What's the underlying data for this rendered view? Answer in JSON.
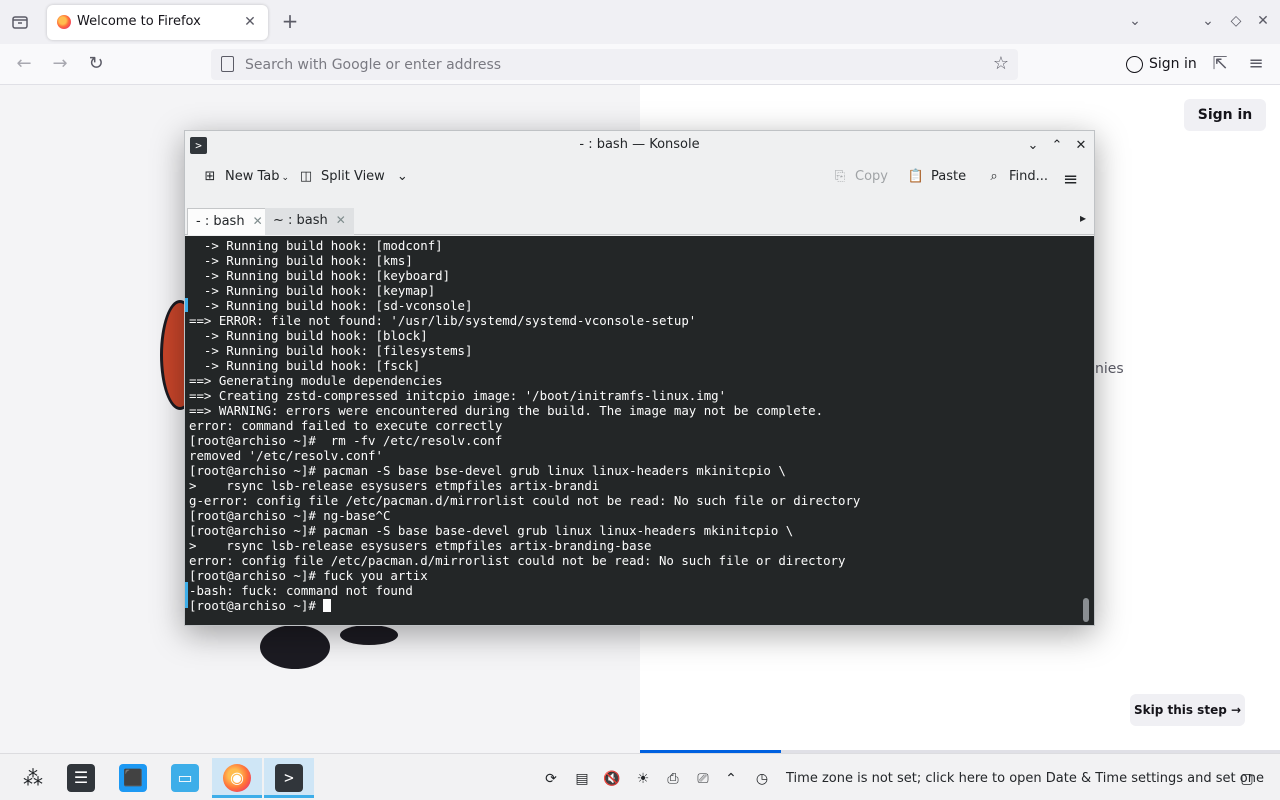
{
  "firefox": {
    "tab_title": "Welcome to Firefox",
    "close_tab_glyph": "✕",
    "new_tab_glyph": "+",
    "url_placeholder": "Search with Google or enter address",
    "signin_label": "Sign in",
    "window_controls": [
      "⌄",
      "⌄",
      "◇",
      "✕"
    ],
    "nav": {
      "back": "←",
      "forward": "→",
      "reload": "↻",
      "star": "☆",
      "extensions": "⇱",
      "menu": "≡"
    }
  },
  "page": {
    "signin_label": "Sign in",
    "text_fragment": "nies",
    "skip_label": "Skip this step →",
    "progress_fraction": 0.22
  },
  "konsole": {
    "title": "- : bash — Konsole",
    "app_icon": ">",
    "window_controls": {
      "minimize": "⌄",
      "maximize": "⌃",
      "close": "✕"
    },
    "toolbar": {
      "new_tab": "New Tab",
      "split_view": "Split View",
      "copy": "Copy",
      "paste": "Paste",
      "find": "Find...",
      "menu": "≡"
    },
    "tabs": [
      {
        "label": "- : bash",
        "close": "✕"
      },
      {
        "label": "~ : bash",
        "close": "✕"
      }
    ],
    "tab_menu_glyph": "▸",
    "lines": [
      "  -> Running build hook: [modconf]",
      "  -> Running build hook: [kms]",
      "  -> Running build hook: [keyboard]",
      "  -> Running build hook: [keymap]",
      "  -> Running build hook: [sd-vconsole]",
      "==> ERROR: file not found: '/usr/lib/systemd/systemd-vconsole-setup'",
      "  -> Running build hook: [block]",
      "  -> Running build hook: [filesystems]",
      "  -> Running build hook: [fsck]",
      "==> Generating module dependencies",
      "==> Creating zstd-compressed initcpio image: '/boot/initramfs-linux.img'",
      "==> WARNING: errors were encountered during the build. The image may not be complete.",
      "error: command failed to execute correctly",
      "[root@archiso ~]#  rm -fv /etc/resolv.conf",
      "removed '/etc/resolv.conf'",
      "[root@archiso ~]# pacman -S base bse-devel grub linux linux-headers mkinitcpio \\",
      ">    rsync lsb-release esysusers etmpfiles artix-brandi",
      "g-error: config file /etc/pacman.d/mirrorlist could not be read: No such file or directory",
      "[root@archiso ~]# ng-base^C",
      "[root@archiso ~]# pacman -S base base-devel grub linux linux-headers mkinitcpio \\",
      ">    rsync lsb-release esysusers etmpfiles artix-branding-base",
      "error: config file /etc/pacman.d/mirrorlist could not be read: No such file or directory",
      "[root@archiso ~]# fuck you artix",
      "-bash: fuck: command not found",
      "[root@archiso ~]# "
    ]
  },
  "taskbar": {
    "apps": [
      {
        "name": "app-launcher",
        "glyph": "⁂"
      },
      {
        "name": "system-settings",
        "glyph": "☰"
      },
      {
        "name": "discover",
        "glyph": "⬛"
      },
      {
        "name": "file-manager",
        "glyph": "▭"
      },
      {
        "name": "firefox",
        "glyph": "◉"
      },
      {
        "name": "konsole",
        "glyph": ">"
      }
    ],
    "tray_icons": [
      "⟳",
      "▤",
      "🔇",
      "☀",
      "⎙",
      "⎚",
      "⌃",
      "◷"
    ],
    "tray_text": "Time zone is not set; click here to open Date & Time settings and set one",
    "show_desktop_glyph": "▢"
  },
  "colors": {
    "terminal_bg": "#232627",
    "terminal_fg": "#fcfcfc",
    "accent": "#3daee9",
    "firefox_progress": "#0061e0"
  }
}
